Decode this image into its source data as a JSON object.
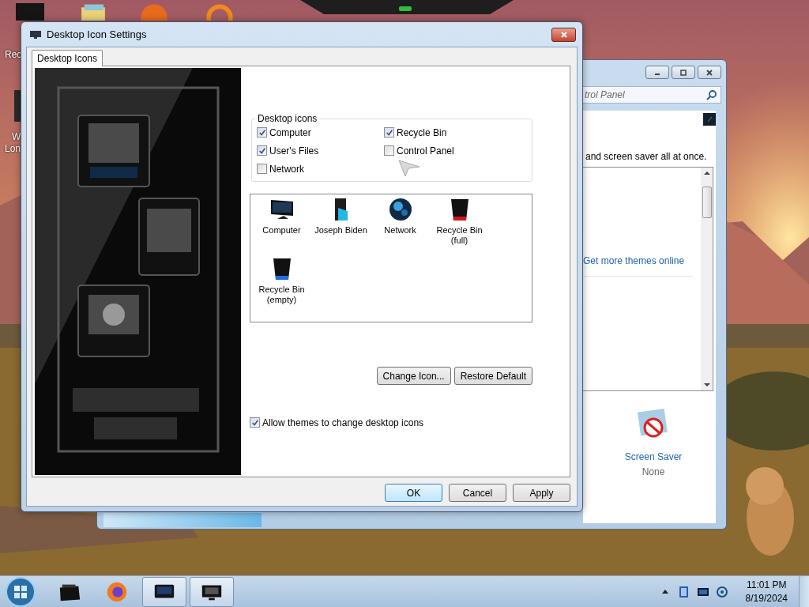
{
  "desktop": {
    "top_icons": [
      {
        "kind": "folder"
      },
      {
        "kind": "orb"
      },
      {
        "kind": "ring"
      }
    ],
    "side_icons": [
      {
        "kind": "bin",
        "label": [
          "Rec"
        ]
      },
      {
        "kind": "app",
        "label": [
          "W",
          "Lon"
        ]
      }
    ]
  },
  "background_window": {
    "search": {
      "placeholder": "trol Panel"
    },
    "description": "and screen saver all at once.",
    "themes_link": "Get more themes online",
    "screen_saver": {
      "label": "Screen Saver",
      "value": "None"
    }
  },
  "dialog": {
    "title": "Desktop Icon Settings",
    "tabs": [
      {
        "label": "Desktop Icons",
        "selected": true
      }
    ],
    "group": {
      "title": "Desktop icons",
      "checkboxes": [
        {
          "label": "Computer",
          "checked": true
        },
        {
          "label": "Recycle Bin",
          "checked": true
        },
        {
          "label": "User's Files",
          "checked": true
        },
        {
          "label": "Control Panel",
          "checked": false
        },
        {
          "label": "Network",
          "checked": false
        }
      ]
    },
    "icons": [
      {
        "kind": "computer",
        "label": "Computer"
      },
      {
        "kind": "user",
        "label": "Joseph Biden"
      },
      {
        "kind": "network",
        "label": "Network"
      },
      {
        "kind": "bin-full",
        "label": "Recycle Bin (full)"
      },
      {
        "kind": "bin-empty",
        "label": "Recycle Bin (empty)"
      }
    ],
    "actions": [
      "Change Icon...",
      "Restore Default"
    ],
    "allow_themes": {
      "label": "Allow themes to change desktop icons",
      "checked": true
    },
    "buttons": [
      {
        "label": "OK",
        "default": true
      },
      {
        "label": "Cancel",
        "default": false
      },
      {
        "label": "Apply",
        "default": false
      }
    ]
  },
  "taskbar": {
    "items": [
      {
        "kind": "printer",
        "active": false
      },
      {
        "kind": "firefox",
        "active": false
      },
      {
        "kind": "display",
        "active": true
      },
      {
        "kind": "monitor",
        "active": true
      }
    ],
    "tray": [
      {
        "kind": "arrow"
      },
      {
        "kind": "book"
      },
      {
        "kind": "screen"
      },
      {
        "kind": "network"
      }
    ],
    "time": "11:01 PM",
    "date": "8/19/2024"
  }
}
